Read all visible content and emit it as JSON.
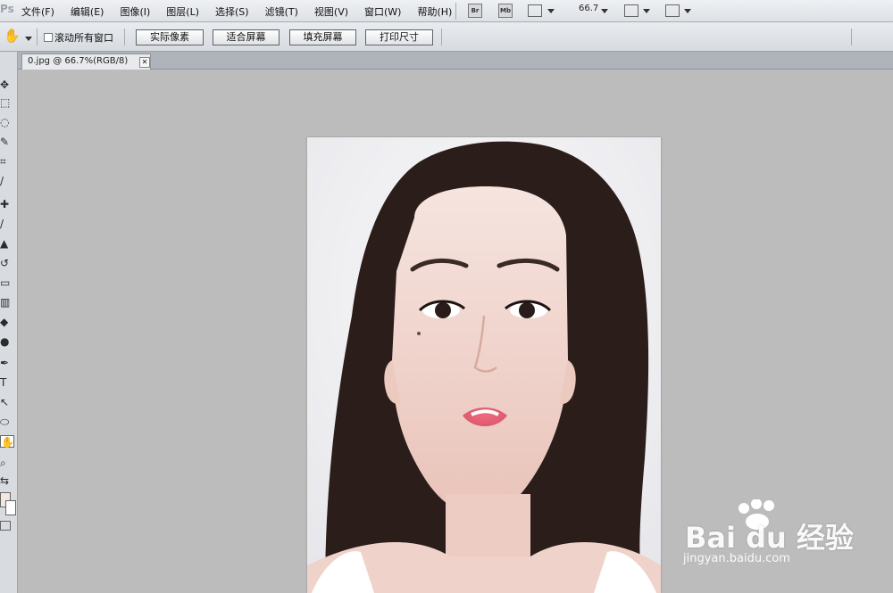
{
  "app": {
    "logo": "Ps"
  },
  "menu": [
    "文件(F)",
    "编辑(E)",
    "图像(I)",
    "图层(L)",
    "选择(S)",
    "滤镜(T)",
    "视图(V)",
    "窗口(W)",
    "帮助(H)"
  ],
  "menubar_buttons": {
    "bridge": "Br",
    "mini_bridge": "Mb",
    "zoom": "66.7"
  },
  "options": {
    "checkbox_label": "滚动所有窗口",
    "checked": false,
    "buttons": [
      "实际像素",
      "适合屏幕",
      "填充屏幕",
      "打印尺寸"
    ]
  },
  "document": {
    "tab_title": "0.jpg @ 66.7%(RGB/8)"
  },
  "watermark": {
    "brand": "Bai du 经验",
    "url": "jingyan.baidu.com"
  },
  "colors": {
    "canvas_bg": "#bcbcbc",
    "chrome": "#e1e4e8",
    "skin": "#f3d8d2",
    "hair": "#2a1d1a"
  }
}
